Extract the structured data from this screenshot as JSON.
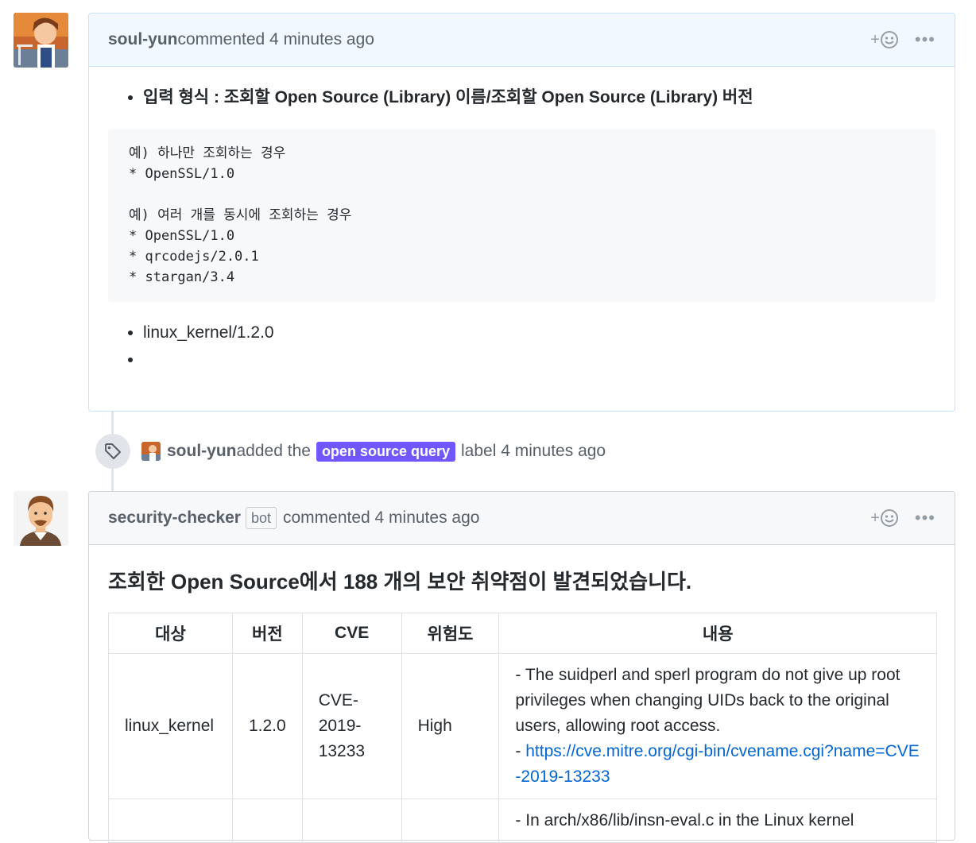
{
  "comment1": {
    "author": "soul-yun",
    "action_text": " commented 4 minutes ago",
    "bullet1": "입력 형식 : 조회할 Open Source (Library) 이름/조회할 Open Source (Library) 버전",
    "code_lines": [
      "예) 하나만 조회하는 경우",
      "* OpenSSL/1.0",
      "",
      "예) 여러 개를 동시에 조회하는 경우",
      "* OpenSSL/1.0",
      "* qrcodejs/2.0.1",
      "* stargan/3.4"
    ],
    "bullet2": "linux_kernel/1.2.0",
    "bullet3": ""
  },
  "event": {
    "author": "soul-yun",
    "text_before": " added the ",
    "label": "open source query",
    "label_color": "#7057ff",
    "text_after": " label 4 minutes ago",
    "icon": "tag-icon"
  },
  "comment2": {
    "author": "security-checker",
    "badge": "bot",
    "action_text": "commented 4 minutes ago",
    "heading": "조회한 Open Source에서 188 개의 보안 취약점이 발견되었습니다.",
    "table": {
      "headers": [
        "대상",
        "버전",
        "CVE",
        "위험도",
        "내용"
      ],
      "rows": [
        {
          "target": "linux_kernel",
          "version": "1.2.0",
          "cve": "CVE-2019-13233",
          "risk": "High",
          "desc": "- The suidperl and sperl program do not give up root privileges when changing UIDs back to the original users, allowing root access.",
          "link_prefix": "- ",
          "link": "https://cve.mitre.org/cgi-bin/cvename.cgi?name=CVE-2019-13233"
        },
        {
          "target": "",
          "version": "",
          "cve": "",
          "risk": "",
          "desc": "- In arch/x86/lib/insn-eval.c in the Linux kernel"
        }
      ]
    }
  },
  "icons": {
    "reaction": "smiley-icon",
    "menu": "kebab-icon"
  },
  "colors": {
    "header_bg_blue": "#f1f8ff",
    "border_blue": "#c8e1ff",
    "link": "#0366d6"
  }
}
